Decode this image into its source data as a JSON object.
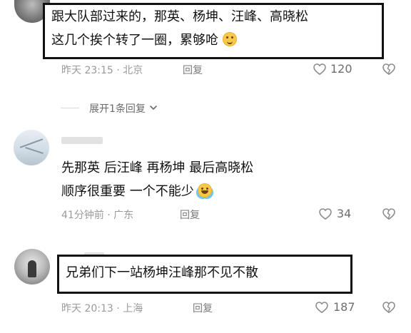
{
  "comments": [
    {
      "text_lines": [
        "跟大队部过来的，那英、杨坤、汪峰、高晓松",
        "这几个挨个转了一圈，累够呛"
      ],
      "emoji": "smiling-face",
      "meta": "昨天 23:15 · 北京",
      "reply_label": "回复",
      "likes": "120",
      "expand_replies": "展开1条回复"
    },
    {
      "text_lines": [
        "先那英 后汪峰 再杨坤 最后高晓松",
        "顺序很重要 一个不能少"
      ],
      "emoji": "laughing-tears-face",
      "meta": "41分钟前 · 广东",
      "reply_label": "回复",
      "likes": "34"
    },
    {
      "text_lines": [
        "兄弟们下一站杨坤汪峰那不见不散"
      ],
      "meta": "昨天 20:13 · 上海",
      "reply_label": "回复",
      "likes": "187"
    }
  ],
  "icons": {
    "like": "heart-outline-icon",
    "dislike": "broken-heart-icon",
    "expand": "chevron-down-icon"
  }
}
